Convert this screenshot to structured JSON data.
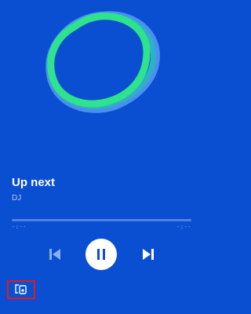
{
  "now_playing": {
    "title": "Up next",
    "artist": "DJ"
  },
  "progress": {
    "elapsed": "-:--",
    "remaining": "-:--",
    "fraction": 0
  },
  "controls": {
    "previous_icon": "skip-previous-icon",
    "play_state_icon": "pause-icon",
    "next_icon": "skip-next-icon",
    "devices_icon": "connect-devices-icon"
  },
  "colors": {
    "background": "#0a4fd1",
    "artwork_ring": "#2fe38c",
    "devices_highlight": "#e21a1a"
  }
}
